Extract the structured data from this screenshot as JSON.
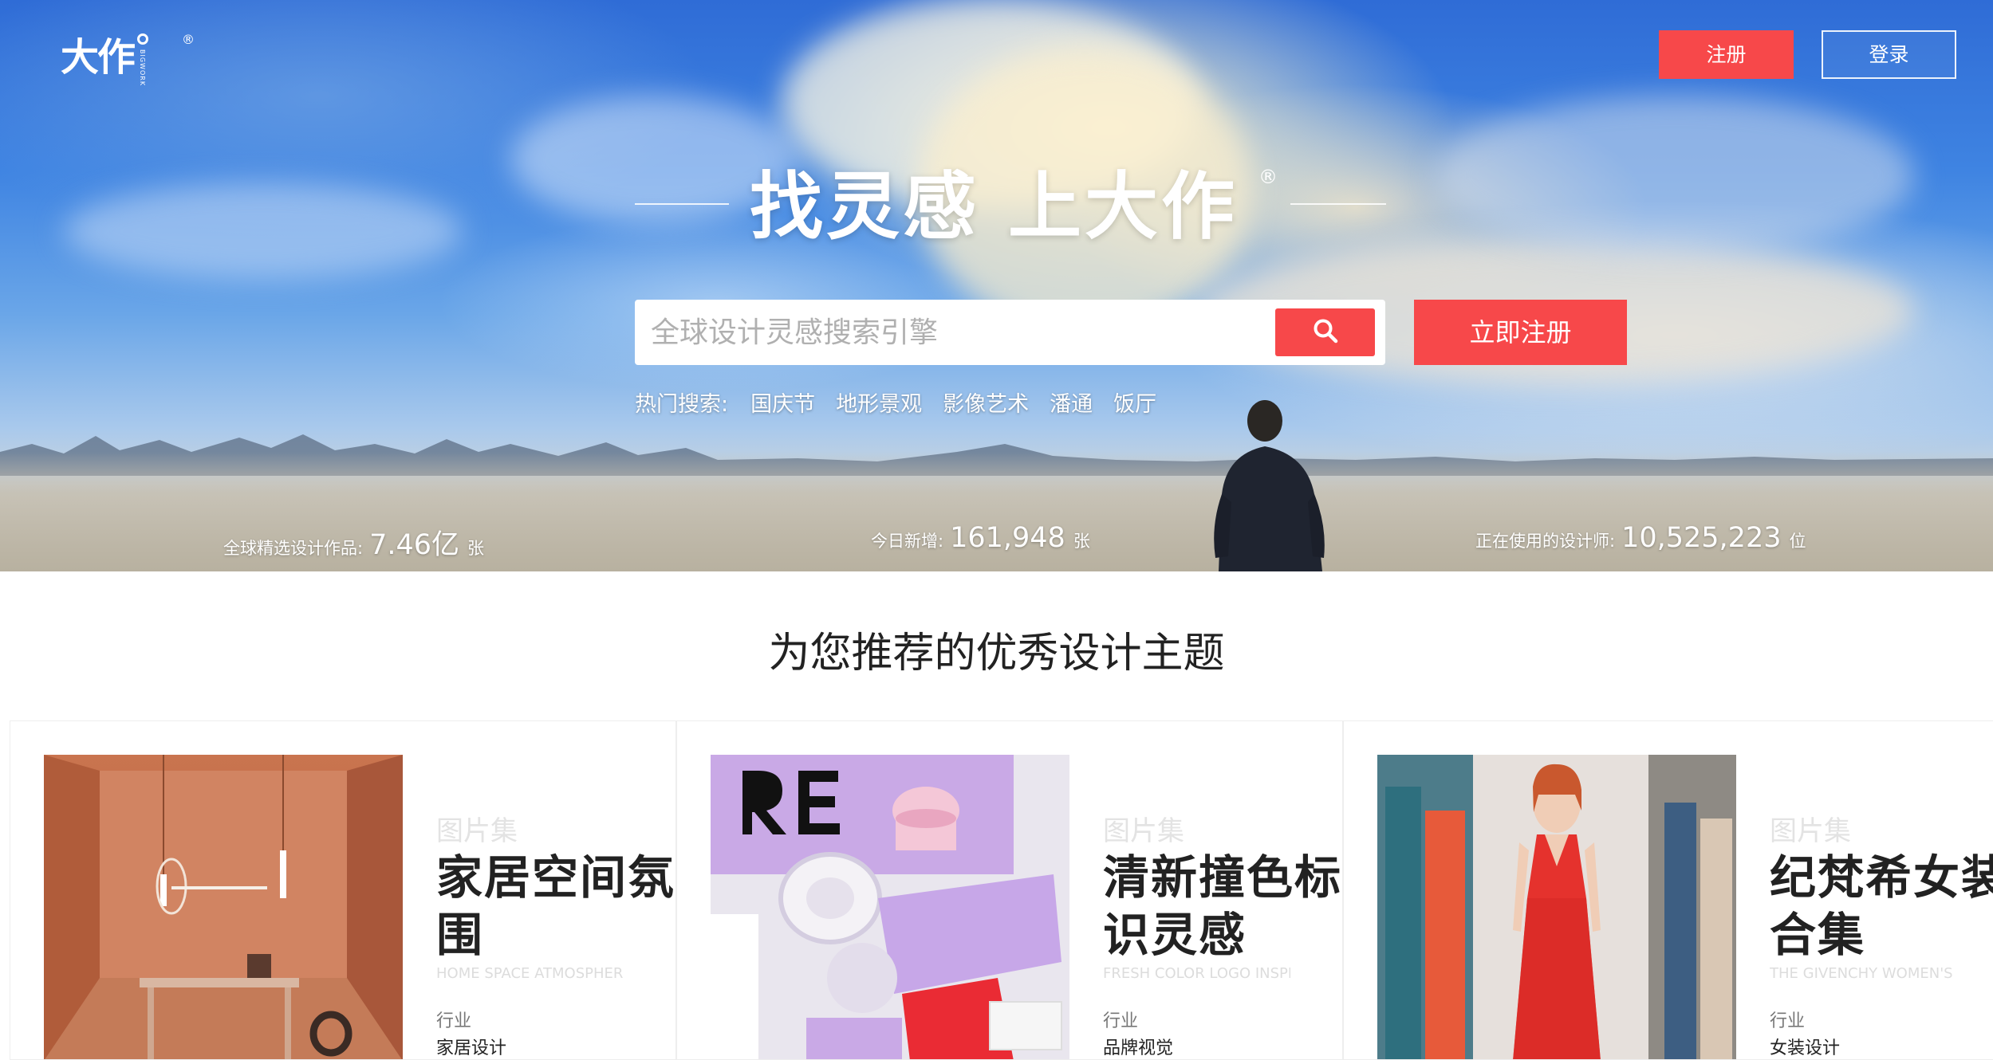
{
  "header": {
    "logo_text": "大作",
    "logo_sub": "BIGWORK",
    "logo_reg": "®",
    "register_label": "注册",
    "login_label": "登录"
  },
  "hero": {
    "slogan": "找灵感  上大作",
    "slogan_reg": "®",
    "search_placeholder": "全球设计灵感搜索引擎",
    "search_icon": "search-icon",
    "cta_label": "立即注册",
    "hot_label": "热门搜索:",
    "hot_items": [
      "国庆节",
      "地形景观",
      "影像艺术",
      "潘通",
      "饭厅"
    ],
    "stats": [
      {
        "label": "全球精选设计作品:",
        "value": "7.46亿",
        "unit": "张"
      },
      {
        "label": "今日新增:",
        "value": "161,948",
        "unit": "张"
      },
      {
        "label": "正在使用的设计师:",
        "value": "10,525,223",
        "unit": "位"
      }
    ]
  },
  "section": {
    "title": "为您推荐的优秀设计主题"
  },
  "cards": [
    {
      "type": "图片集",
      "title": "家居空间氛围",
      "title_en": "HOME SPACE ATMOSPHERE",
      "cat_label": "行业",
      "cat": "家居设计"
    },
    {
      "type": "图片集",
      "title": "清新撞色标识灵感",
      "title_en": "FRESH COLOR LOGO INSPIRATION",
      "cat_label": "行业",
      "cat": "品牌视觉"
    },
    {
      "type": "图片集",
      "title": "纪梵希女装合集",
      "title_en": "THE GIVENCHY WOMEN'S COLLECTION",
      "cat_label": "行业",
      "cat": "女装设计"
    }
  ],
  "colors": {
    "accent": "#f7484a",
    "sky": "#3f84e2",
    "text": "#222222"
  }
}
